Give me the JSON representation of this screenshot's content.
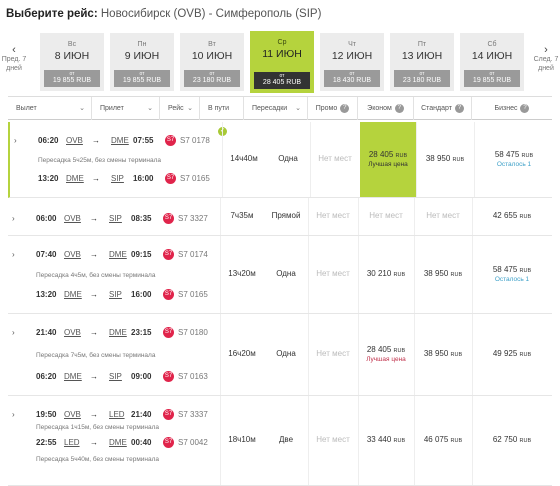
{
  "header": {
    "label": "Выберите рейс:",
    "route": "Новосибирск (OVB) - Симферополь (SIP)"
  },
  "nav": {
    "prev_label": "Пред. 7 дней",
    "next_label": "След. 7 дней"
  },
  "dates": [
    {
      "weekday": "Вс",
      "date": "8 ИЮН",
      "price": "19 855 RUB",
      "from": "от"
    },
    {
      "weekday": "Пн",
      "date": "9 ИЮН",
      "price": "19 855 RUB",
      "from": "от"
    },
    {
      "weekday": "Вт",
      "date": "10 ИЮН",
      "price": "23 180 RUB",
      "from": "от"
    },
    {
      "weekday": "Ср",
      "date": "11 ИЮН",
      "price": "28 405 RUB",
      "from": "от"
    },
    {
      "weekday": "Чт",
      "date": "12 ИЮН",
      "price": "18 430 RUB",
      "from": "от"
    },
    {
      "weekday": "Пт",
      "date": "13 ИЮН",
      "price": "23 180 RUB",
      "from": "от"
    },
    {
      "weekday": "Сб",
      "date": "14 ИЮН",
      "price": "19 855 RUB",
      "from": "от"
    }
  ],
  "columns": {
    "depart": "Вылет",
    "arrive": "Прилет",
    "flight": "Рейс",
    "duration": "В пути",
    "transfers": "Пересадки",
    "promo": "Промо",
    "economy": "Эконом",
    "standard": "Стандарт",
    "business": "Бизнес"
  },
  "rows": [
    {
      "segments": [
        {
          "dep_time": "06:20",
          "dep_ap": "OVB",
          "arr_ap": "DME",
          "arr_time": "07:55",
          "carrier": "S7",
          "flight": "S7 0178"
        },
        {
          "dep_time": "13:20",
          "dep_ap": "DME",
          "arr_ap": "SIP",
          "arr_time": "16:00",
          "carrier": "S7",
          "flight": "S7 0165"
        }
      ],
      "transfer_note": "Пересадка 5ч25м, без смены терминала",
      "duration": "14ч40м",
      "transfers": "Одна",
      "promo": "Нет мест",
      "economy": "28 405",
      "economy_sub": "Лучшая цена",
      "standard": "38 950",
      "business": "58 475",
      "business_sub": "Осталось 1"
    },
    {
      "segments": [
        {
          "dep_time": "06:00",
          "dep_ap": "OVB",
          "arr_ap": "SIP",
          "arr_time": "08:35",
          "carrier": "S7",
          "flight": "S7 3327"
        }
      ],
      "transfer_note": "",
      "duration": "7ч35м",
      "transfers": "Прямой",
      "promo": "Нет мест",
      "economy": "Нет мест",
      "economy_sub": "",
      "standard": "Нет мест",
      "business": "42 655",
      "business_sub": ""
    },
    {
      "segments": [
        {
          "dep_time": "07:40",
          "dep_ap": "OVB",
          "arr_ap": "DME",
          "arr_time": "09:15",
          "carrier": "S7",
          "flight": "S7 0174"
        },
        {
          "dep_time": "13:20",
          "dep_ap": "DME",
          "arr_ap": "SIP",
          "arr_time": "16:00",
          "carrier": "S7",
          "flight": "S7 0165"
        }
      ],
      "transfer_note": "Пересадка 4ч5м, без смены терминала",
      "duration": "13ч20м",
      "transfers": "Одна",
      "promo": "Нет мест",
      "economy": "30 210",
      "economy_sub": "",
      "standard": "38 950",
      "business": "58 475",
      "business_sub": "Осталось 1"
    },
    {
      "segments": [
        {
          "dep_time": "21:40",
          "dep_ap": "OVB",
          "arr_ap": "DME",
          "arr_time": "23:15",
          "carrier": "S7",
          "flight": "S7 0180"
        },
        {
          "dep_time": "06:20",
          "dep_ap": "DME",
          "arr_ap": "SIP",
          "arr_time": "09:00",
          "carrier": "S7",
          "flight": "S7 0163"
        }
      ],
      "transfer_note": "Пересадка 7ч5м, без смены терминала",
      "duration": "16ч20м",
      "transfers": "Одна",
      "promo": "Нет мест",
      "economy": "28 405",
      "economy_sub": "Лучшая цена",
      "standard": "38 950",
      "business": "49 925",
      "business_sub": ""
    },
    {
      "segments": [
        {
          "dep_time": "19:50",
          "dep_ap": "OVB",
          "arr_ap": "LED",
          "arr_time": "21:40",
          "carrier": "S7",
          "flight": "S7 3337"
        },
        {
          "dep_time": "22:55",
          "dep_ap": "LED",
          "arr_ap": "DME",
          "arr_time": "00:40",
          "carrier": "S7",
          "flight": "S7 0042"
        }
      ],
      "transfer_note": "Пересадка 1ч15м, без смены терминала",
      "transfer_note2": "Пересадка 5ч40м, без смены терминала",
      "duration": "18ч10м",
      "transfers": "Две",
      "promo": "Нет мест",
      "economy": "33 440",
      "economy_sub": "",
      "standard": "46 075",
      "business": "62 750",
      "business_sub": ""
    }
  ],
  "currency": "RUB",
  "colors": {
    "accent": "#b5d33d",
    "brand": "#e0244b",
    "seat": "#3da0c8"
  }
}
